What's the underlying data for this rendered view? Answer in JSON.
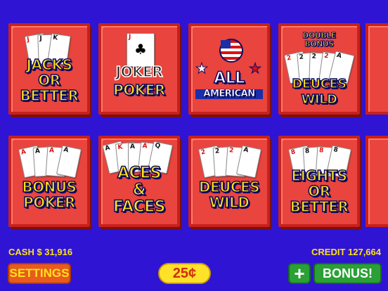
{
  "games": [
    {
      "id": "jacks",
      "lines": [
        "JACKS",
        "OR",
        "BETTER"
      ],
      "cards": [
        "J",
        "J",
        "K"
      ]
    },
    {
      "id": "joker",
      "lines": [
        "JOKER",
        "POKER"
      ],
      "cards": [
        "J"
      ]
    },
    {
      "id": "american",
      "lines": [
        "ALL",
        "AMERICAN"
      ]
    },
    {
      "id": "double-bonus-deuces",
      "top": [
        "DOUBLE",
        "BONUS"
      ],
      "lines": [
        "DEUCES",
        "WILD"
      ],
      "cards": [
        "2",
        "2",
        "2",
        "2",
        "A"
      ]
    },
    {
      "id": "bonus-poker",
      "lines": [
        "BONUS",
        "POKER"
      ],
      "cards": [
        "A",
        "A",
        "A",
        "A"
      ]
    },
    {
      "id": "aces-faces",
      "lines": [
        "ACES",
        "&",
        "FACES"
      ],
      "cards": [
        "A",
        "K",
        "A",
        "A",
        "Q"
      ]
    },
    {
      "id": "deuces-wild",
      "lines": [
        "DEUCES",
        "WILD"
      ],
      "cards": [
        "2",
        "2",
        "2",
        "A"
      ]
    },
    {
      "id": "eights",
      "lines": [
        "EIGHTS",
        "OR",
        "BETTER"
      ],
      "cards": [
        "8",
        "8",
        "8",
        "8"
      ]
    }
  ],
  "footer": {
    "cash": "CASH $ 31,916",
    "credit": "CREDIT 127,664",
    "settings": "SETTINGS",
    "denomination": "25¢",
    "plus": "+",
    "bonus": "BONUS!"
  },
  "colors": {
    "background": "#2f14d4",
    "tile": "#e9443d",
    "title": "#ffe21a",
    "button_green": "#2aa036"
  }
}
